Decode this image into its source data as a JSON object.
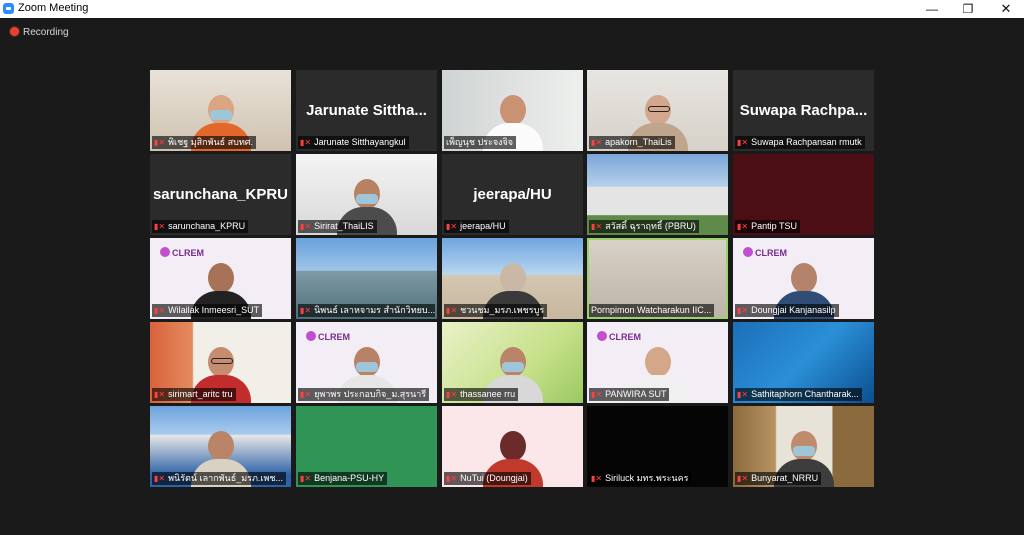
{
  "window": {
    "title": "Zoom Meeting",
    "minimize_icon": "minimize-icon",
    "maximize_icon": "restore-icon",
    "close_icon": "close-icon"
  },
  "recording": {
    "label": "Recording"
  },
  "participants": [
    {
      "name": "พิเชฐ มุสิกพันธ์ สบทศ.",
      "muted": true
    },
    {
      "name": "Jarunate Sitthayangkul",
      "muted": true,
      "big_name": "Jarunate  Sittha..."
    },
    {
      "name": "เพ็ญนุช ประจงจิจ",
      "muted": false
    },
    {
      "name": "apakorn_ThaiLis",
      "muted": true
    },
    {
      "name": "Suwapa Rachpansan rmutk",
      "muted": true,
      "big_name": "Suwapa  Rachpa..."
    },
    {
      "name": "sarunchana_KPRU",
      "muted": true,
      "big_name": "sarunchana_KPRU"
    },
    {
      "name": "Sirirat_ThaiLIS",
      "muted": true
    },
    {
      "name": "jeerapa/HU",
      "muted": true,
      "big_name": "jeerapa/HU"
    },
    {
      "name": "สวัสดิ์ ฉุราฤทธิ์ (PBRU)",
      "muted": true
    },
    {
      "name": "Pantip TSU",
      "muted": true
    },
    {
      "name": "Wilailak Inmeesri_SUT",
      "muted": true
    },
    {
      "name": "นิพนธ์ เลาหจามร สำนักวิทยบ...",
      "muted": true
    },
    {
      "name": "ชวนชม_มรภ.เพชรบูร",
      "muted": true
    },
    {
      "name": "Pornpimon Watcharakun IIC...",
      "muted": false
    },
    {
      "name": "Doungjai Kanjanasilp",
      "muted": true
    },
    {
      "name": "sirimart_aritc tru",
      "muted": true
    },
    {
      "name": "ยุพาพร ประกอบกิจ_ม.สุรนารี",
      "muted": true
    },
    {
      "name": "thassanee rru",
      "muted": true
    },
    {
      "name": "PANWIRA SUT",
      "muted": true
    },
    {
      "name": "Sathitaphorn Chantharak...",
      "muted": true
    },
    {
      "name": "พนิรัตน์ เลากพันธ์_มรภ.เพช...",
      "muted": true
    },
    {
      "name": "Benjana-PSU-HY",
      "muted": true
    },
    {
      "name": "NuTui (Doungjai)",
      "muted": true
    },
    {
      "name": "Siriluck มทร.พระนคร",
      "muted": true
    },
    {
      "name": "Bunyarat_NRRU",
      "muted": true
    }
  ],
  "logo": {
    "text": "CLREM"
  },
  "colors": {
    "background": "#1a1a1a",
    "speaking_border": "#9ad36a",
    "muted_mic": "#ff4040"
  }
}
